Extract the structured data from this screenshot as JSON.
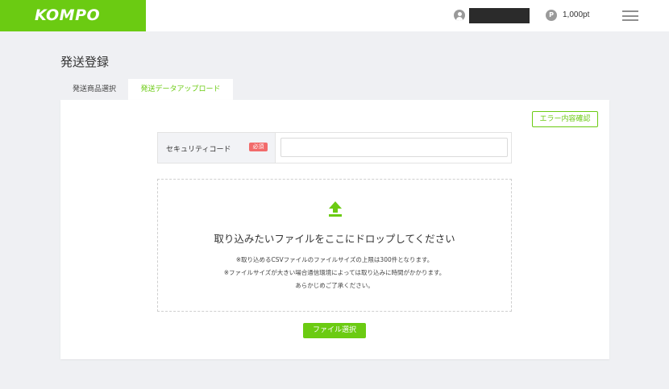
{
  "header": {
    "logo_text": "KOMPO",
    "user_icon": "user-icon",
    "point_icon_letter": "P",
    "points": "1,000pt",
    "menu_icon": "hamburger-menu-icon",
    "brand_color": "#6bcb12"
  },
  "page": {
    "title": "発送登録"
  },
  "tabs": [
    {
      "label": "発送商品選択",
      "active": false
    },
    {
      "label": "発送データアップロード",
      "active": true
    }
  ],
  "form": {
    "error_button_label": "エラー内容確認",
    "security_label": "セキュリティコード",
    "required_badge": "必須",
    "security_value": "",
    "security_placeholder": ""
  },
  "dropzone": {
    "icon": "upload-icon",
    "title": "取り込みたいファイルをここにドロップしてください",
    "notes": [
      "※取り込めるCSVファイルのファイルサイズの上限は300件となります。",
      "※ファイルサイズが大きい場合通信環境によっては取り込みに時間がかかります。",
      "あらかじめご了承ください。"
    ]
  },
  "file_button_label": "ファイル選択",
  "colors": {
    "accent": "#6bcb12",
    "required": "#f26b6b",
    "background": "#eff0f3"
  }
}
